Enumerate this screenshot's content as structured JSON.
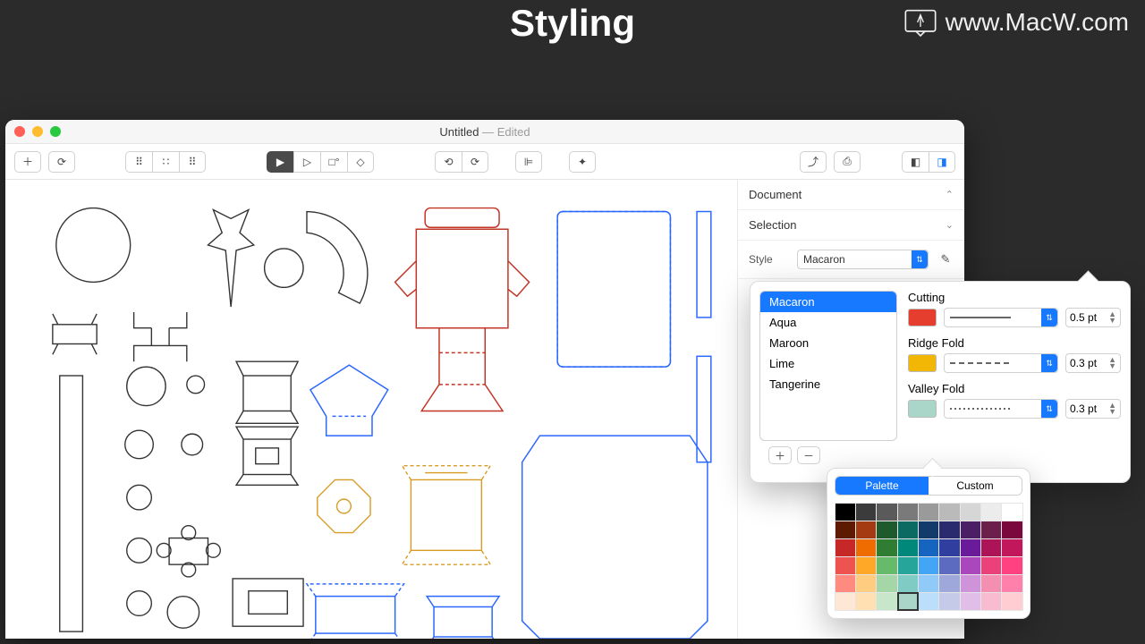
{
  "page": {
    "title": "Styling",
    "watermark": "www.MacW.com"
  },
  "window": {
    "title": "Untitled",
    "subtitle": " — Edited"
  },
  "inspector": {
    "document": "Document",
    "selection": "Selection",
    "style_label": "Style",
    "style_value": "Macaron"
  },
  "style_popover": {
    "presets": [
      "Macaron",
      "Aqua",
      "Maroon",
      "Lime",
      "Tangerine"
    ],
    "selected_preset": "Macaron",
    "lines": {
      "cutting": {
        "label": "Cutting",
        "color": "#e63e2e",
        "dash": "solid",
        "size": "0.5 pt"
      },
      "ridge": {
        "label": "Ridge Fold",
        "color": "#f2b705",
        "dash": "dashed",
        "size": "0.3 pt"
      },
      "valley": {
        "label": "Valley Fold",
        "color": "#a9d6c8",
        "dash": "dotted",
        "size": "0.3 pt"
      }
    }
  },
  "palette_popover": {
    "tabs": {
      "palette": "Palette",
      "custom": "Custom"
    },
    "selected_color": "#a9d6c8",
    "colors": [
      "#000000",
      "#3b3b3b",
      "#5a5a5a",
      "#7a7a7a",
      "#9a9a9a",
      "#bababa",
      "#d6d6d6",
      "#ececec",
      "#ffffff",
      "#5c1a00",
      "#a33a12",
      "#1f5a2d",
      "#0b6b63",
      "#123a6b",
      "#2a2a6f",
      "#4a1f66",
      "#6b1f4a",
      "#7a083d",
      "#c62828",
      "#ef6c00",
      "#2e7d32",
      "#00897b",
      "#1565c0",
      "#303f9f",
      "#6a1b9a",
      "#ad1457",
      "#c2185b",
      "#ef5350",
      "#ffa726",
      "#66bb6a",
      "#26a69a",
      "#42a5f5",
      "#5c6bc0",
      "#ab47bc",
      "#ec407a",
      "#ff4081",
      "#ff8a80",
      "#ffcc80",
      "#a5d6a7",
      "#80cbc4",
      "#90caf9",
      "#9fa8da",
      "#ce93d8",
      "#f48fb1",
      "#ff80ab",
      "#ffe7d6",
      "#ffe0b2",
      "#c8e6c9",
      "#a9d6c8",
      "#bbdefb",
      "#c5cae9",
      "#e1bee7",
      "#f8bbd0",
      "#ffcdd2"
    ]
  }
}
